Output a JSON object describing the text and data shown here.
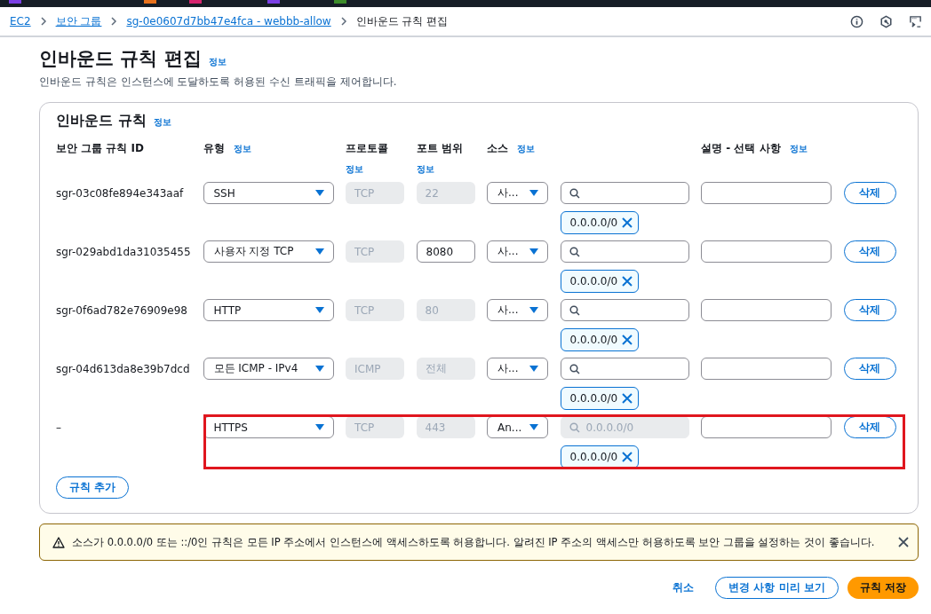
{
  "browser_tabs": [
    {
      "color": "#7b3fe4"
    },
    {
      "color": "#e8711c"
    },
    {
      "color": "#d6246e"
    },
    {
      "color": "#7b3fe4"
    },
    {
      "color": "#3d8c2a"
    }
  ],
  "breadcrumbs": [
    {
      "label": "EC2",
      "link": true
    },
    {
      "label": "보안 그룹",
      "link": true
    },
    {
      "label": "sg-0e0607d7bb47e4fca - webbb-allow",
      "link": true
    },
    {
      "label": "인바운드 규칙 편집",
      "link": false
    }
  ],
  "page": {
    "title": "인바운드 규칙 편집",
    "info": "정보",
    "description": "인바운드 규칙은 인스턴스에 도달하도록 허용된 수신 트래픽을 제어합니다."
  },
  "panel": {
    "title": "인바운드 규칙",
    "info": "정보",
    "columns": [
      {
        "label": "보안 그룹 규칙 ID"
      },
      {
        "label": "유형",
        "info": "정보"
      },
      {
        "label": "프로토콜",
        "info": "정보"
      },
      {
        "label": "포트 범위",
        "info": "정보"
      },
      {
        "label": "소스",
        "info": "정보"
      },
      {
        "label": "설명 - 선택 사항",
        "info": "정보"
      }
    ],
    "rows": [
      {
        "id": "sgr-03c08fe894e343aaf",
        "type": "SSH",
        "protocol": "TCP",
        "port": "22",
        "port_disabled": true,
        "source": "사...",
        "search_placeholder": "",
        "search_disabled": false,
        "chip": "0.0.0.0/0",
        "delete": "삭제",
        "highlighted": false
      },
      {
        "id": "sgr-029abd1da31035455",
        "type": "사용자 지정 TCP",
        "protocol": "TCP",
        "port": "8080",
        "port_disabled": false,
        "source": "사...",
        "search_placeholder": "",
        "search_disabled": false,
        "chip": "0.0.0.0/0",
        "delete": "삭제",
        "highlighted": false
      },
      {
        "id": "sgr-0f6ad782e76909e98",
        "type": "HTTP",
        "protocol": "TCP",
        "port": "80",
        "port_disabled": true,
        "source": "사...",
        "search_placeholder": "",
        "search_disabled": false,
        "chip": "0.0.0.0/0",
        "delete": "삭제",
        "highlighted": false
      },
      {
        "id": "sgr-04d613da8e39b7dcd",
        "type": "모든 ICMP - IPv4",
        "protocol": "ICMP",
        "port": "전체",
        "port_disabled": true,
        "source": "사...",
        "search_placeholder": "",
        "search_disabled": false,
        "chip": "0.0.0.0/0",
        "delete": "삭제",
        "highlighted": false
      },
      {
        "id": "–",
        "type": "HTTPS",
        "protocol": "TCP",
        "port": "443",
        "port_disabled": true,
        "source": "An...",
        "search_placeholder": "0.0.0.0/0",
        "search_disabled": true,
        "chip": "0.0.0.0/0",
        "delete": "삭제",
        "highlighted": true
      }
    ],
    "add_button": "규칙 추가"
  },
  "warning": {
    "text": "소스가 0.0.0.0/0 또는 ::/0인 규칙은 모든 IP 주소에서 인스턴스에 액세스하도록 허용합니다. 알려진 IP 주소의 액세스만 허용하도록 보안 그룹을 설정하는 것이 좋습니다."
  },
  "footer": {
    "cancel": "취소",
    "preview": "변경 사항 미리 보기",
    "save": "규칙 저장"
  }
}
